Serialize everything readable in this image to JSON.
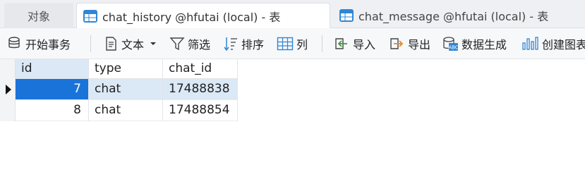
{
  "tabs": [
    {
      "label": "对象"
    },
    {
      "label": "chat_history @hfutai (local) - 表"
    },
    {
      "label": "chat_message @hfutai (local) - 表"
    }
  ],
  "toolbar": {
    "begin_transaction": "开始事务",
    "text": "文本",
    "filter": "筛选",
    "sort": "排序",
    "columns": "列",
    "import": "导入",
    "export": "导出",
    "data_generation": "数据生成",
    "create_chart": "创建图表"
  },
  "table": {
    "columns": [
      "id",
      "type",
      "chat_id"
    ],
    "rows": [
      {
        "id": "7",
        "type": "chat",
        "chat_id": "17488838"
      },
      {
        "id": "8",
        "type": "chat",
        "chat_id": "17488854"
      }
    ]
  },
  "colors": {
    "accent": "#1a73d9",
    "selection": "#dbe8f6",
    "table_icon": "#2f86d6"
  }
}
